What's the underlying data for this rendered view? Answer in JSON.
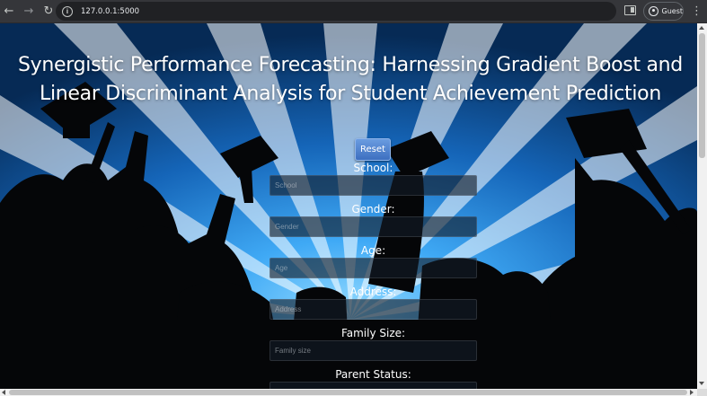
{
  "browser": {
    "back_icon": "arrow-left-icon",
    "forward_icon": "arrow-right-icon",
    "reload_icon": "reload-icon",
    "site_info_icon": "info-icon",
    "url": "127.0.0.1:5000",
    "side_panel_icon": "side-panel-icon",
    "profile_label": "Guest",
    "menu_icon": "kebab-menu-icon"
  },
  "page": {
    "title_line1": "Synergistic Performance Forecasting: Harnessing Gradient Boost and",
    "title_line2": "Linear Discriminant Analysis for Student Achievement Prediction",
    "reset_label": "Reset",
    "fields": [
      {
        "label": "School:",
        "placeholder": "School"
      },
      {
        "label": "Gender:",
        "placeholder": "Gender"
      },
      {
        "label": "Age:",
        "placeholder": "Age"
      },
      {
        "label": "Address:",
        "placeholder": "Address"
      },
      {
        "label": "Family Size:",
        "placeholder": "Family size"
      },
      {
        "label": "Parent Status:",
        "placeholder": ""
      }
    ]
  },
  "colors": {
    "sky_top": "#0b3a6e",
    "sky_bright": "#3fa9f5",
    "silhouette": "#050608",
    "reset_button": "#4a7fd0"
  }
}
